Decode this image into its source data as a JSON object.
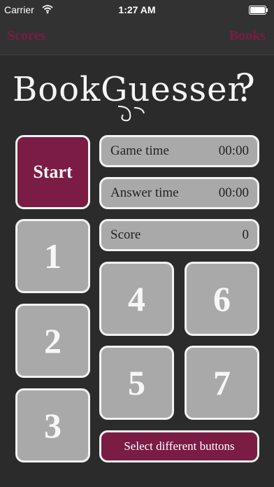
{
  "status_bar": {
    "carrier": "Carrier",
    "time": "1:27 AM",
    "wifi_icon": "wifi-icon",
    "battery_icon": "battery-icon"
  },
  "nav": {
    "left": "Scores",
    "right": "Books"
  },
  "logo": {
    "text": "BookGuesser",
    "mark": "?"
  },
  "start_label": "Start",
  "info": {
    "game_time_label": "Game time",
    "game_time_value": "00:00",
    "answer_time_label": "Answer time",
    "answer_time_value": "00:00",
    "score_label": "Score",
    "score_value": "0"
  },
  "buttons": {
    "b1": "1",
    "b2": "2",
    "b3": "3",
    "b4": "4",
    "b5": "5",
    "b6": "6",
    "b7": "7"
  },
  "select_label": "Select different buttons",
  "colors": {
    "background": "#2b2b2b",
    "accent": "#7a1c44",
    "button_gray": "#a9a9a9",
    "border": "#f2f2f2"
  }
}
